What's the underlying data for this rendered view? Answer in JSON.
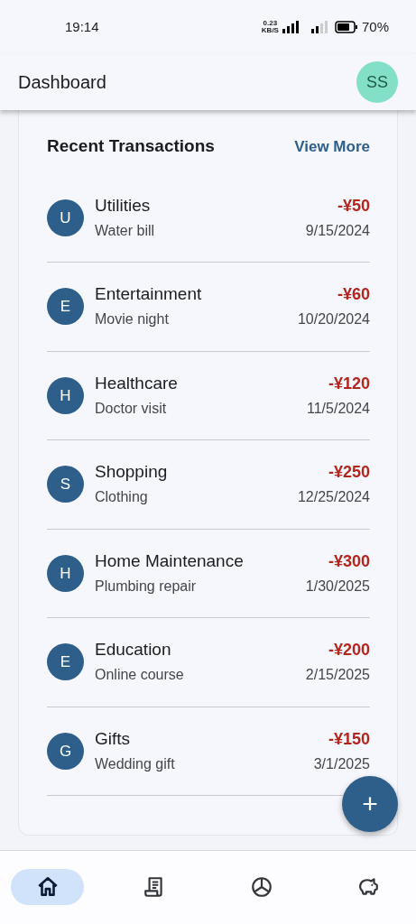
{
  "status_bar": {
    "time": "19:14",
    "speed": "0.23",
    "speed_unit": "KB/S",
    "battery": "70%"
  },
  "app_bar": {
    "title": "Dashboard",
    "avatar": "SS"
  },
  "section": {
    "title": "Recent Transactions",
    "action": "View More"
  },
  "transactions": [
    {
      "initial": "U",
      "category": "Utilities",
      "note": "Water bill",
      "amount": "-¥50",
      "date": "9/15/2024"
    },
    {
      "initial": "E",
      "category": "Entertainment",
      "note": "Movie night",
      "amount": "-¥60",
      "date": "10/20/2024"
    },
    {
      "initial": "H",
      "category": "Healthcare",
      "note": "Doctor visit",
      "amount": "-¥120",
      "date": "11/5/2024"
    },
    {
      "initial": "S",
      "category": "Shopping",
      "note": "Clothing",
      "amount": "-¥250",
      "date": "12/25/2024"
    },
    {
      "initial": "H",
      "category": "Home Maintenance",
      "note": "Plumbing repair",
      "amount": "-¥300",
      "date": "1/30/2025"
    },
    {
      "initial": "E",
      "category": "Education",
      "note": "Online course",
      "amount": "-¥200",
      "date": "2/15/2025"
    },
    {
      "initial": "G",
      "category": "Gifts",
      "note": "Wedding gift",
      "amount": "-¥150",
      "date": "3/1/2025"
    }
  ],
  "fab": {
    "label": "+"
  },
  "nav": [
    {
      "kind": "home",
      "selected": true
    },
    {
      "kind": "receipt",
      "selected": false
    },
    {
      "kind": "chart",
      "selected": false
    },
    {
      "kind": "savings",
      "selected": false
    }
  ]
}
